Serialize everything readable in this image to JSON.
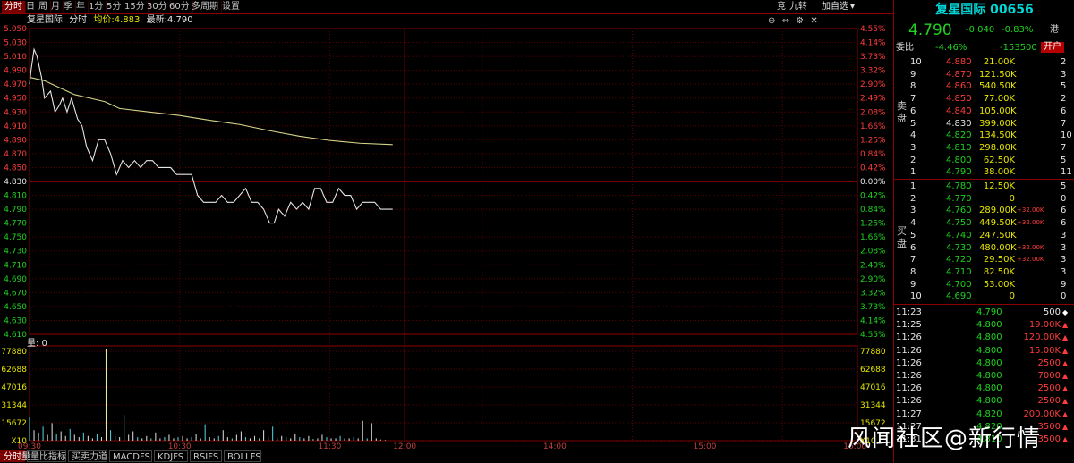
{
  "toolbar": {
    "tabs": [
      "分时",
      "日",
      "周",
      "月",
      "季",
      "年",
      "1分",
      "5分",
      "15分",
      "30分",
      "60分",
      "多周期",
      "设置"
    ],
    "active_tab": "分时",
    "right_items": [
      "竞",
      "九转",
      "加自选"
    ]
  },
  "info_bar": {
    "name": "复星国际",
    "mode": "分时",
    "avg_label": "均价:",
    "avg_value": "4.883",
    "latest_label": "最新:",
    "latest_value": "4.790"
  },
  "volume_label": "量: 0",
  "bottom_tabs": [
    "分时量",
    "量比指标",
    "买卖力道",
    "MACDFS",
    "KDJFS",
    "RSIFS",
    "BOLLFS"
  ],
  "bottom_active": "分时量",
  "watermark": "风闻社区@新行情",
  "colors": {
    "up": "#ff3c3c",
    "down": "#1fd31f",
    "price_line": "#e6e6e6",
    "avg_line": "#d6d68a",
    "grid": "#8b0000",
    "accent_cyan": "#00d7d7"
  },
  "chart_data": [
    {
      "type": "line",
      "title": "",
      "x_ticks": [
        "09:30",
        "10:30",
        "11:30",
        "12:00",
        "14:00",
        "15:00",
        "16:00"
      ],
      "y_price_ticks": [
        "5.050",
        "5.030",
        "5.010",
        "4.990",
        "4.970",
        "4.950",
        "4.930",
        "4.910",
        "4.890",
        "4.870",
        "4.850",
        "4.830",
        "4.810",
        "4.790",
        "4.770",
        "4.750",
        "4.730",
        "4.710",
        "4.690",
        "4.670",
        "4.650",
        "4.630",
        "4.610"
      ],
      "y_pct_ticks": [
        "4.55%",
        "4.14%",
        "3.73%",
        "3.32%",
        "2.90%",
        "2.49%",
        "2.08%",
        "1.66%",
        "1.25%",
        "0.84%",
        "0.42%",
        "0.00%",
        "0.42%",
        "0.84%",
        "1.25%",
        "1.66%",
        "2.08%",
        "2.49%",
        "2.90%",
        "3.32%",
        "3.73%",
        "4.14%",
        "4.55%"
      ],
      "prev_close": 4.83,
      "ylim": [
        4.61,
        5.05
      ],
      "series": [
        {
          "x": [
            0,
            1,
            3,
            5,
            8,
            10,
            14,
            17,
            20,
            22,
            25,
            28,
            32,
            35,
            38,
            42,
            46,
            50,
            54,
            58,
            62,
            66,
            70,
            74,
            78,
            82,
            86,
            90,
            94,
            98,
            102,
            108,
            112,
            116,
            118,
            120,
            124,
            128,
            132,
            136,
            140,
            144,
            148,
            152,
            156,
            160,
            163,
            166,
            170,
            174,
            178,
            182,
            186,
            190,
            194,
            198,
            202,
            206,
            210,
            214,
            218,
            222,
            226,
            230,
            234,
            238,
            242
          ],
          "y": [
            4.97,
            4.99,
            5.02,
            5.01,
            4.98,
            4.95,
            4.96,
            4.93,
            4.94,
            4.95,
            4.93,
            4.95,
            4.92,
            4.91,
            4.88,
            4.86,
            4.89,
            4.89,
            4.87,
            4.84,
            4.86,
            4.85,
            4.86,
            4.85,
            4.86,
            4.86,
            4.85,
            4.85,
            4.85,
            4.84,
            4.84,
            4.84,
            4.81,
            4.8,
            4.8,
            4.8,
            4.8,
            4.81,
            4.8,
            4.8,
            4.81,
            4.82,
            4.8,
            4.8,
            4.79,
            4.77,
            4.77,
            4.79,
            4.78,
            4.8,
            4.79,
            4.8,
            4.79,
            4.82,
            4.82,
            4.8,
            4.8,
            4.82,
            4.81,
            4.81,
            4.79,
            4.8,
            4.8,
            4.8,
            4.79,
            4.79,
            4.79
          ]
        },
        {
          "x": [
            0,
            10,
            20,
            30,
            40,
            50,
            60,
            80,
            100,
            120,
            140,
            160,
            180,
            200,
            220,
            242
          ],
          "y": [
            4.98,
            4.975,
            4.965,
            4.955,
            4.95,
            4.945,
            4.935,
            4.93,
            4.925,
            4.918,
            4.912,
            4.903,
            4.895,
            4.889,
            4.885,
            4.883
          ]
        }
      ],
      "volume_ticks": [
        "77880",
        "62688",
        "47016",
        "31344",
        "15672",
        "X10"
      ],
      "volume_ylim": [
        0,
        77880
      ],
      "volume": [
        20000,
        9000,
        7000,
        12000,
        5000,
        15000,
        6000,
        8000,
        4000,
        10000,
        5000,
        3000,
        7000,
        4000,
        2000,
        6000,
        3000,
        77880,
        9000,
        4000,
        3000,
        22000,
        5000,
        8000,
        3000,
        2000,
        4000,
        2000,
        7000,
        2000,
        3000,
        5000,
        2000,
        3000,
        4000,
        2000,
        3000,
        6000,
        2000,
        14000,
        3000,
        2000,
        4000,
        9000,
        3000,
        2000,
        5000,
        8000,
        3000,
        2000,
        4000,
        2000,
        9000,
        3000,
        12000,
        2000,
        4000,
        3000,
        2000,
        6000,
        3000,
        2000,
        4000,
        1500,
        2000,
        5000,
        3000,
        2000,
        2000,
        4000,
        2000,
        2000,
        3000,
        2000,
        17000,
        2000,
        15000,
        2000,
        1000,
        500
      ]
    }
  ],
  "quote": {
    "title": "复星国际 00656",
    "price": "4.790",
    "change": "-0.040",
    "change_pct": "-0.83%",
    "tag": "港",
    "weibi_label": "委比",
    "weibi_pct": "-4.46%",
    "weicha": "-153500",
    "open_btn": "开户",
    "side_sell": "卖盘",
    "side_buy": "买盘",
    "sell": [
      {
        "lvl": "10",
        "price": "4.880",
        "vol": "21.00K",
        "cnt": "2"
      },
      {
        "lvl": "9",
        "price": "4.870",
        "vol": "121.50K",
        "cnt": "3"
      },
      {
        "lvl": "8",
        "price": "4.860",
        "vol": "540.50K",
        "cnt": "5"
      },
      {
        "lvl": "7",
        "price": "4.850",
        "vol": "77.00K",
        "cnt": "2"
      },
      {
        "lvl": "6",
        "price": "4.840",
        "vol": "105.00K",
        "cnt": "6"
      },
      {
        "lvl": "5",
        "price": "4.830",
        "vol": "399.00K",
        "cnt": "7"
      },
      {
        "lvl": "4",
        "price": "4.820",
        "vol": "134.50K",
        "cnt": "10"
      },
      {
        "lvl": "3",
        "price": "4.810",
        "vol": "298.00K",
        "cnt": "7"
      },
      {
        "lvl": "2",
        "price": "4.800",
        "vol": "62.50K",
        "cnt": "5"
      },
      {
        "lvl": "1",
        "price": "4.790",
        "vol": "38.00K",
        "cnt": "11"
      }
    ],
    "buy": [
      {
        "lvl": "1",
        "price": "4.780",
        "vol": "12.50K",
        "chg": "",
        "cnt": "5"
      },
      {
        "lvl": "2",
        "price": "4.770",
        "vol": "0",
        "chg": "",
        "cnt": "0"
      },
      {
        "lvl": "3",
        "price": "4.760",
        "vol": "289.00K",
        "chg": "+32.00K",
        "cnt": "6"
      },
      {
        "lvl": "4",
        "price": "4.750",
        "vol": "449.50K",
        "chg": "+32.00K",
        "cnt": "6"
      },
      {
        "lvl": "5",
        "price": "4.740",
        "vol": "247.50K",
        "chg": "",
        "cnt": "3"
      },
      {
        "lvl": "6",
        "price": "4.730",
        "vol": "480.00K",
        "chg": "+32.00K",
        "cnt": "3"
      },
      {
        "lvl": "7",
        "price": "4.720",
        "vol": "29.50K",
        "chg": "+32.00K",
        "cnt": "3"
      },
      {
        "lvl": "8",
        "price": "4.710",
        "vol": "82.50K",
        "chg": "",
        "cnt": "3"
      },
      {
        "lvl": "9",
        "price": "4.700",
        "vol": "53.00K",
        "chg": "",
        "cnt": "9"
      },
      {
        "lvl": "10",
        "price": "4.690",
        "vol": "0",
        "chg": "",
        "cnt": "0"
      }
    ],
    "ticks": [
      {
        "time": "11:23",
        "price": "4.790",
        "vol": "500",
        "dir": "flat"
      },
      {
        "time": "11:25",
        "price": "4.800",
        "vol": "19.00K",
        "dir": "up"
      },
      {
        "time": "11:26",
        "price": "4.800",
        "vol": "120.00K",
        "dir": "up"
      },
      {
        "time": "11:26",
        "price": "4.800",
        "vol": "15.00K",
        "dir": "up"
      },
      {
        "time": "11:26",
        "price": "4.800",
        "vol": "2500",
        "dir": "up"
      },
      {
        "time": "11:26",
        "price": "4.800",
        "vol": "7000",
        "dir": "up"
      },
      {
        "time": "11:26",
        "price": "4.800",
        "vol": "2500",
        "dir": "up"
      },
      {
        "time": "11:26",
        "price": "4.800",
        "vol": "2500",
        "dir": "up"
      },
      {
        "time": "11:27",
        "price": "4.820",
        "vol": "200.00K",
        "dir": "up"
      },
      {
        "time": "11:27",
        "price": "4.820",
        "vol": "3500",
        "dir": "up"
      },
      {
        "time": "11:31",
        "price": "4.810",
        "vol": "3500",
        "dir": "up"
      }
    ]
  }
}
